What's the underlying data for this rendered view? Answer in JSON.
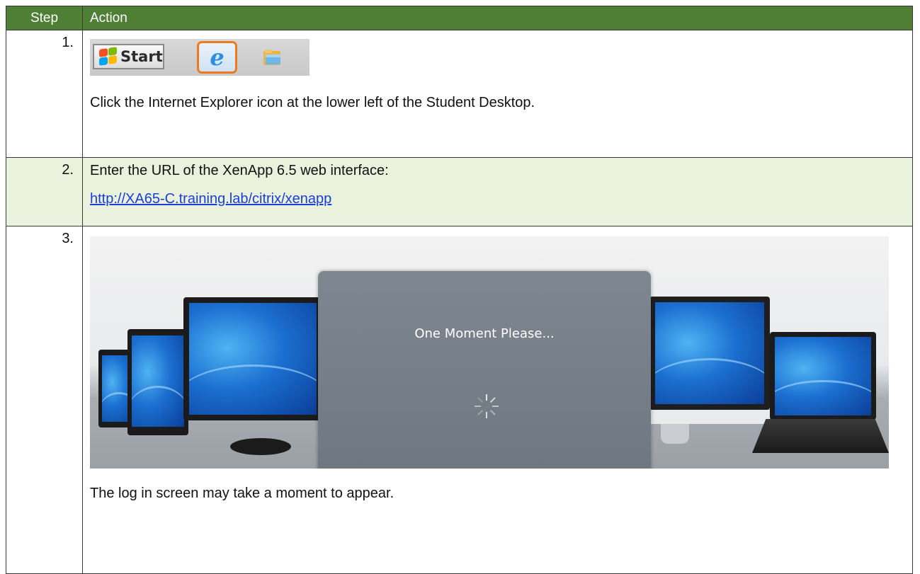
{
  "table": {
    "header": {
      "step": "Step",
      "action": "Action"
    }
  },
  "steps": [
    {
      "number": "1.",
      "taskbar": {
        "start_label": "Start",
        "ie_icon": "internet-explorer-icon",
        "folder_icon": "folder-icon",
        "highlight_color": "#ef7a1e"
      },
      "text": "Click the Internet Explorer icon at the lower left of the Student Desktop."
    },
    {
      "number": "2.",
      "text": "Enter the URL of the XenApp 6.5 web interface:",
      "link": "http://XA65-C.training.lab/citrix/xenapp"
    },
    {
      "number": "3.",
      "screenshot": {
        "dialog_text": "One Moment Please...",
        "spinner_icon": "loading-spinner-icon"
      },
      "text": "The log in screen may take a moment to appear."
    }
  ],
  "colors": {
    "header_bg": "#4f7f35",
    "row2_bg": "#eaf1dd",
    "link": "#1a3fd8"
  }
}
